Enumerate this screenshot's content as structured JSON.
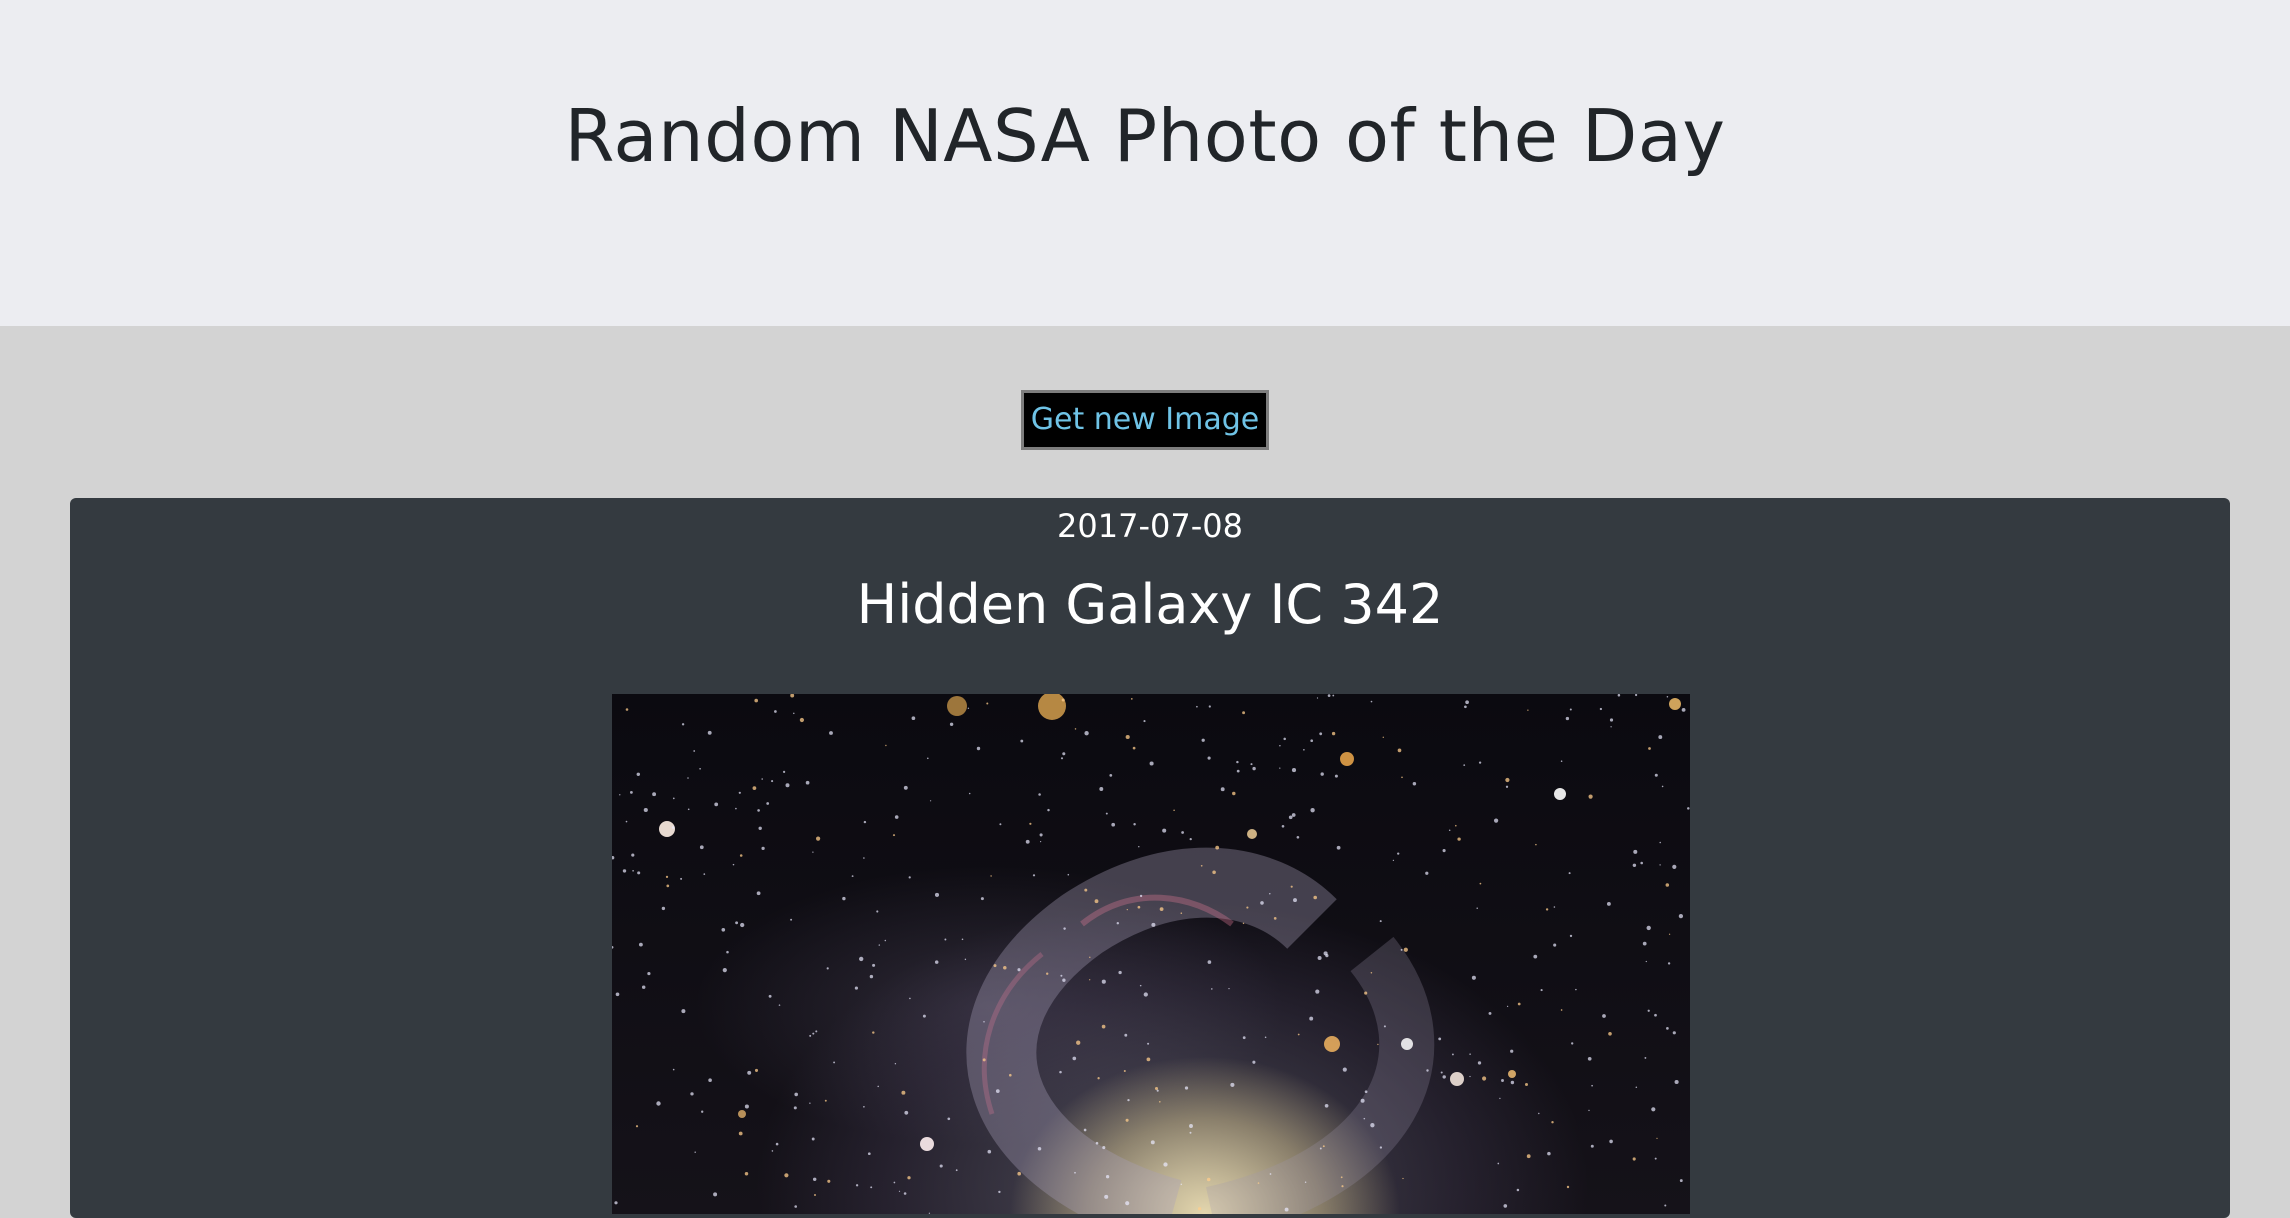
{
  "header": {
    "title": "Random NASA Photo of the Day"
  },
  "controls": {
    "new_image_label": "Get new Image"
  },
  "apod": {
    "date": "2017-07-08",
    "title": "Hidden Galaxy IC 342"
  },
  "colors": {
    "header_bg": "#ecedf1",
    "page_bg": "#d3d3d3",
    "card_bg": "#343a40",
    "button_bg": "#000000",
    "button_text": "#6fc3e6"
  }
}
